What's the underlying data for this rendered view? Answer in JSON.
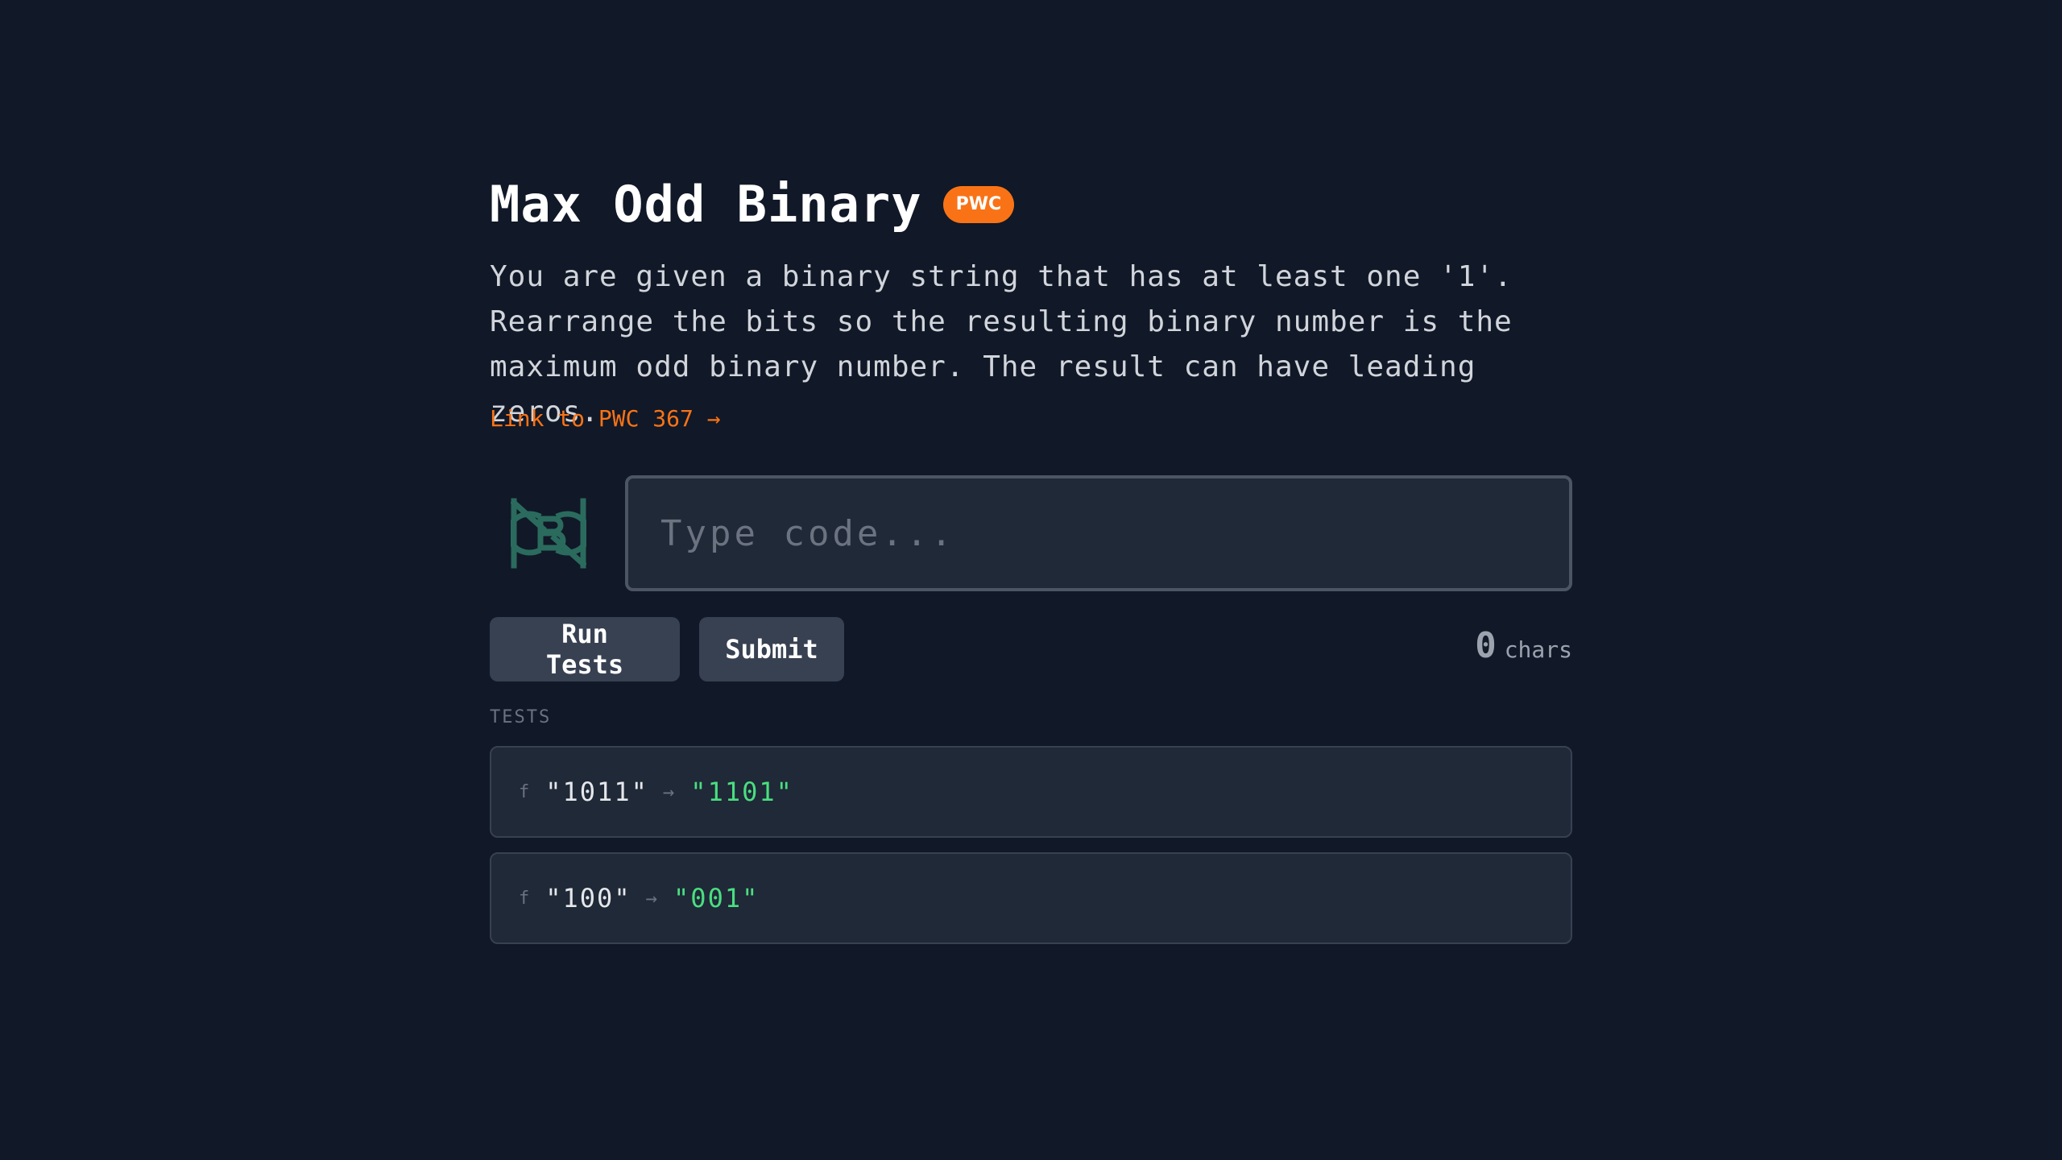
{
  "problem": {
    "title": "Max Odd Binary",
    "badge": "PWC",
    "description": "You are given a binary string that has at least one '1'. Rearrange the bits so the resulting binary number is the maximum odd binary number. The result can have leading zeros.",
    "link_text": "Link to PWC 367 →"
  },
  "editor": {
    "placeholder": "Type code...",
    "value": ""
  },
  "actions": {
    "run_label": "Run Tests",
    "submit_label": "Submit"
  },
  "stats": {
    "char_count": "0",
    "char_label": "chars"
  },
  "tests": {
    "heading": "TESTS",
    "items": [
      {
        "fn": "f",
        "input": "\"1011\"",
        "arrow": "→",
        "expected": "\"1101\""
      },
      {
        "fn": "f",
        "input": "\"100\"",
        "arrow": "→",
        "expected": "\"001\""
      }
    ]
  },
  "colors": {
    "background": "#111827",
    "accent": "#f97316",
    "success": "#4ade80",
    "logo": "#2a6b5e"
  },
  "icons": {
    "logo": "nrb-logo-icon"
  }
}
